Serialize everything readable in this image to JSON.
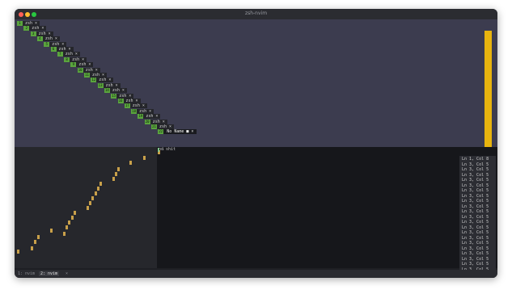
{
  "window": {
    "title": "zsh-nvim"
  },
  "tabs": [
    {
      "num": "1",
      "label": "zsh ×"
    },
    {
      "num": "2",
      "label": "zsh ×"
    },
    {
      "num": "3",
      "label": "zsh ×"
    },
    {
      "num": "4",
      "label": "zsh ×"
    },
    {
      "num": "5",
      "label": "zsh ×"
    },
    {
      "num": "6",
      "label": "zsh ×"
    },
    {
      "num": "7",
      "label": "zsh ×"
    },
    {
      "num": "8",
      "label": "zsh ×"
    },
    {
      "num": "9",
      "label": "zsh ×"
    },
    {
      "num": "10",
      "label": "zsh ×"
    },
    {
      "num": "11",
      "label": "zsh ×"
    },
    {
      "num": "12",
      "label": "zsh ×"
    },
    {
      "num": "13",
      "label": "zsh ×"
    },
    {
      "num": "14",
      "label": "zsh ×"
    },
    {
      "num": "15",
      "label": "zsh ×"
    },
    {
      "num": "16",
      "label": "zsh ×"
    },
    {
      "num": "17",
      "label": "zsh ×"
    },
    {
      "num": "18",
      "label": "zsh ×"
    },
    {
      "num": "19",
      "label": "zsh ×"
    },
    {
      "num": "20",
      "label": "zsh ×"
    },
    {
      "num": "21",
      "label": "zsh ×"
    }
  ],
  "active_buffer": {
    "num": "22",
    "label": "No Name ■ ×"
  },
  "editor": {
    "line_number": "1",
    "text": "no shit"
  },
  "status_lines": [
    "Ln 1, Col 8",
    "Ln 3, Col 5",
    "Ln 3, Col 5",
    "Ln 3, Col 5",
    "Ln 3, Col 5",
    "Ln 3, Col 5",
    "Ln 3, Col 5",
    "Ln 3, Col 5",
    "Ln 3, Col 5",
    "Ln 3, Col 5",
    "Ln 3, Col 5",
    "Ln 3, Col 5",
    "Ln 3, Col 5",
    "Ln 3, Col 5",
    "Ln 3, Col 5",
    "Ln 3, Col 5",
    "Ln 3, Col 5",
    "Ln 3, Col 5",
    "Ln 3, Col 5",
    "Ln 3, Col 5",
    "Ln 3, Col 5",
    "Ln 3, Col 5"
  ],
  "tmux": {
    "window1": "1: nvim",
    "window2": "2: nvim",
    "window2_suffix": "×"
  },
  "colors": {
    "accent": "#e8b40e",
    "tab_number": "#5aa43e",
    "pane_bg": "#3c3c4f"
  }
}
